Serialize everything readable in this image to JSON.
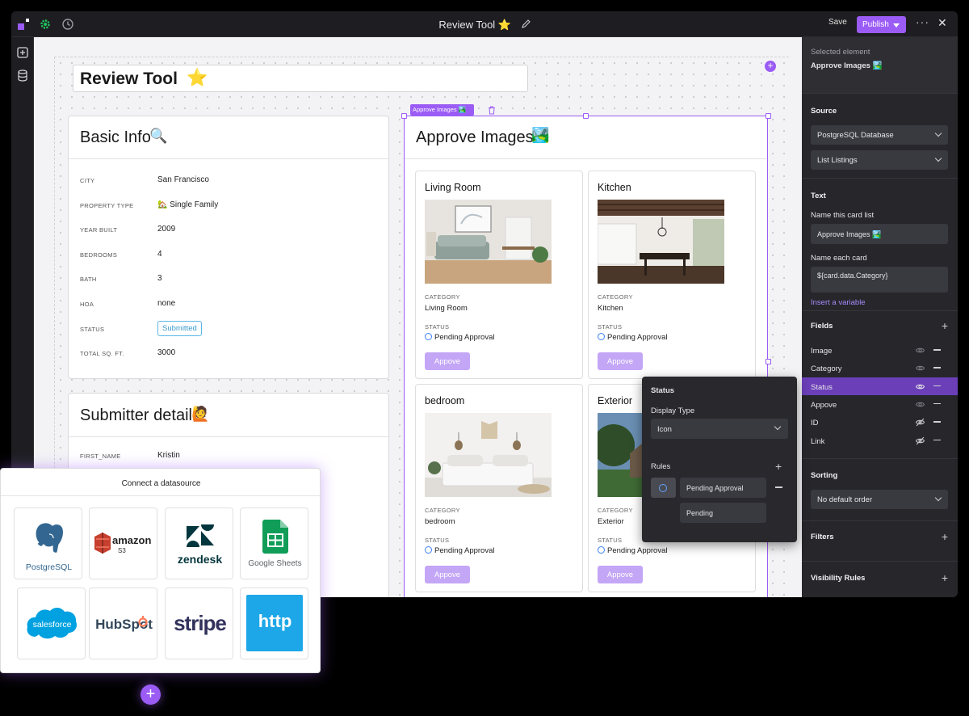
{
  "app": {
    "title": "Review Tool",
    "title_emoji": "⭐",
    "save_label": "Save",
    "publish_label": "Publish",
    "more_label": "···",
    "close_label": "✕",
    "accent": "#9b5cf6"
  },
  "canvas": {
    "page_title": "Review Tool",
    "page_title_emoji": "⭐",
    "basic_info": {
      "title": "Basic Info",
      "title_emoji": "🔍",
      "rows": [
        {
          "label": "CITY",
          "value": "San Francisco"
        },
        {
          "label": "PROPERTY TYPE",
          "value": "🏡 Single Family"
        },
        {
          "label": "YEAR BUILT",
          "value": "2009"
        },
        {
          "label": "BEDROOMS",
          "value": "4"
        },
        {
          "label": "BATH",
          "value": "3"
        },
        {
          "label": "HOA",
          "value": "none"
        },
        {
          "label": "STATUS",
          "value": "Submitted"
        },
        {
          "label": "TOTAL SQ. FT.",
          "value": "3000"
        }
      ]
    },
    "submitter": {
      "title": "Submitter detail",
      "title_emoji": "🙋",
      "rows": [
        {
          "label": "FIRST_NAME",
          "value": "Kristin"
        }
      ]
    },
    "approve": {
      "tag": "Approve Images 🏞️",
      "title": "Approve Images",
      "title_emoji": "🏞️",
      "cards": [
        {
          "title": "Living Room",
          "category_label": "CATEGORY",
          "category": "Living Room",
          "status_label": "STATUS",
          "status": "Pending Approval",
          "button": "Appove"
        },
        {
          "title": "Kitchen",
          "category_label": "CATEGORY",
          "category": "Kitchen",
          "status_label": "STATUS",
          "status": "Pending Approval",
          "button": "Appove"
        },
        {
          "title": "bedroom",
          "category_label": "CATEGORY",
          "category": "bedroom",
          "status_label": "STATUS",
          "status": "Pending Approval",
          "button": "Appove"
        },
        {
          "title": "Exterior",
          "category_label": "CATEGORY",
          "category": "Exterior",
          "status_label": "STATUS",
          "status": "Pending Approval",
          "button": "Appove"
        }
      ]
    }
  },
  "status_popover": {
    "title": "Status",
    "display_type_label": "Display Type",
    "display_type": "Icon",
    "rules_label": "Rules",
    "rule_value": "Pending Approval",
    "rule_match": "Pending"
  },
  "datasource": {
    "title": "Connect a datasource",
    "tiles": [
      {
        "name": "PostgreSQL",
        "icon": "postgres-icon"
      },
      {
        "name": "amazon",
        "sub": "S3",
        "icon": "amazon-s3-icon"
      },
      {
        "name": "zendesk",
        "icon": "zendesk-icon"
      },
      {
        "name": "Google Sheets",
        "icon": "google-sheets-icon"
      },
      {
        "name": "salesforce",
        "icon": "salesforce-icon"
      },
      {
        "name": "HubSpot",
        "icon": "hubspot-icon"
      },
      {
        "name": "stripe",
        "icon": "stripe-icon"
      },
      {
        "name": "http",
        "icon": "http-icon"
      }
    ]
  },
  "right_panel": {
    "selected_label": "Selected element",
    "selected_name": "Approve Images 🏞️",
    "source_title": "Source",
    "source_db": "PostgreSQL Database",
    "source_query": "List Listings",
    "text_title": "Text",
    "name_list_label": "Name this card list",
    "name_list_value": "Approve Images 🏞️",
    "name_card_label": "Name each card",
    "name_card_value": "${card.data.Category}",
    "insert_var": "Insert a variable",
    "fields_title": "Fields",
    "fields": [
      {
        "name": "Image",
        "visible": true
      },
      {
        "name": "Category",
        "visible": true
      },
      {
        "name": "Status",
        "visible": true
      },
      {
        "name": "Appove",
        "visible": true
      },
      {
        "name": "ID",
        "visible": false
      },
      {
        "name": "Link",
        "visible": false
      }
    ],
    "sorting_title": "Sorting",
    "sorting_value": "No default order",
    "filters_title": "Filters",
    "visibility_title": "Visibility Rules"
  }
}
